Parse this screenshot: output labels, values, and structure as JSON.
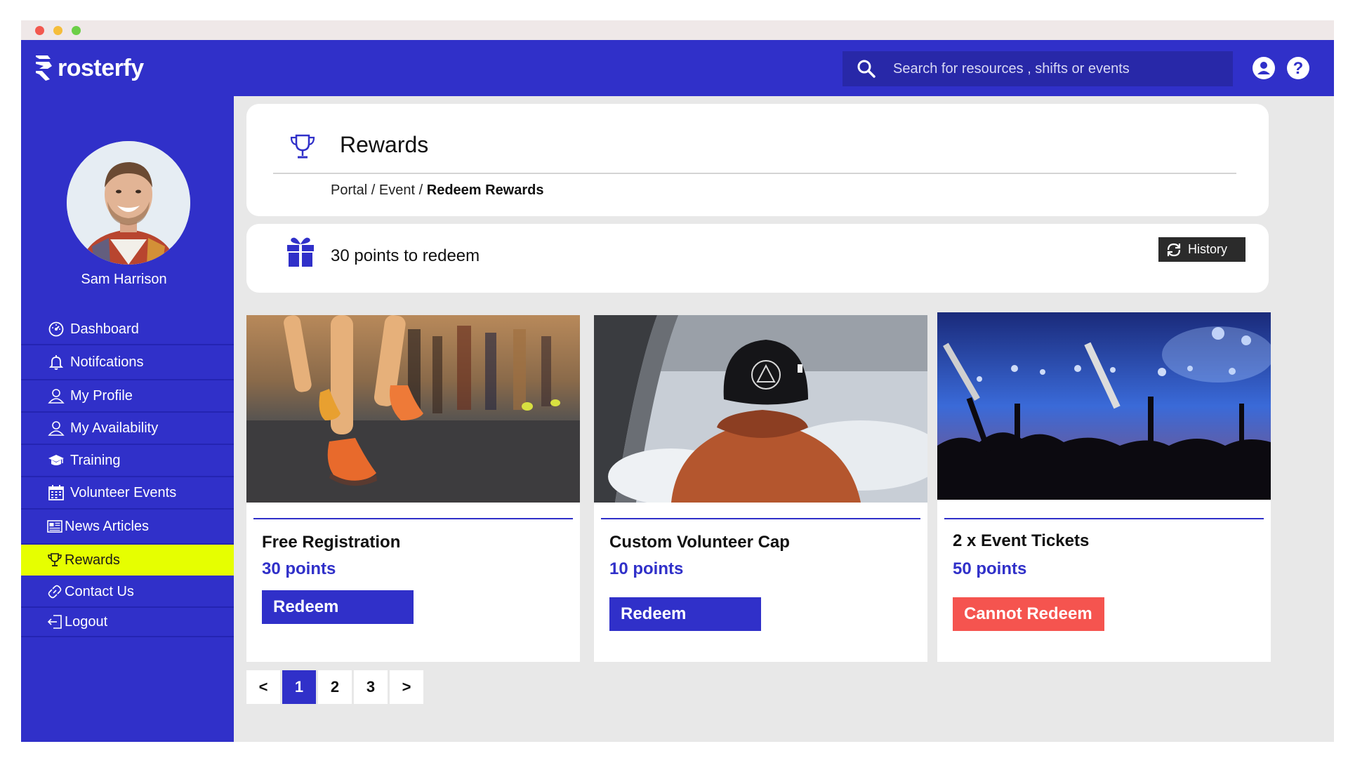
{
  "brand": {
    "name": "rosterfy"
  },
  "search": {
    "placeholder": "Search for resources , shifts or events"
  },
  "header_icons": [
    "user-icon",
    "help-icon"
  ],
  "user": {
    "name": "Sam Harrison"
  },
  "sidebar": {
    "items": [
      {
        "label": "Dashboard",
        "icon": "dashboard-icon"
      },
      {
        "label": "Notifcations",
        "icon": "bell-icon"
      },
      {
        "label": "My Profile",
        "icon": "user-outline-icon"
      },
      {
        "label": "My Availability",
        "icon": "user-outline-icon"
      },
      {
        "label": "Training",
        "icon": "graduation-cap-icon"
      },
      {
        "label": "Volunteer Events",
        "icon": "calendar-icon"
      },
      {
        "label": "News Articles",
        "icon": "newspaper-icon"
      },
      {
        "label": "Rewards",
        "icon": "trophy-icon",
        "active": true
      },
      {
        "label": "Contact Us",
        "icon": "link-icon"
      },
      {
        "label": "Logout",
        "icon": "logout-icon"
      }
    ]
  },
  "page": {
    "title": "Rewards",
    "breadcrumb": {
      "part1": "Portal",
      "sep1": " / ",
      "part2": "Event",
      "sep2": " / ",
      "current": "Redeem Rewards"
    }
  },
  "points": {
    "text": "30 points to redeem",
    "history_label": "History"
  },
  "rewards": [
    {
      "title": "Free Registration",
      "points": "30 points",
      "button": "Redeem",
      "button_style": "primary"
    },
    {
      "title": "Custom Volunteer Cap",
      "points": "10 points",
      "button": "Redeem",
      "button_style": "primary"
    },
    {
      "title": "2 x Event Tickets",
      "points": "50 points",
      "button": "Cannot Redeem",
      "button_style": "danger"
    }
  ],
  "pagination": {
    "prev": "<",
    "pages": [
      "1",
      "2",
      "3"
    ],
    "current": "1",
    "next": ">"
  },
  "colors": {
    "brand": "#3030c9",
    "active_nav": "#e6ff00",
    "danger": "#f5544f",
    "background": "#e8e8e8"
  }
}
